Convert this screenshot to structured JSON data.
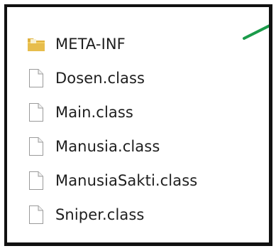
{
  "window": {
    "border_color": "#111111",
    "annotation_arrow_color": "#1a9b4a"
  },
  "files": [
    {
      "name": "META-INF",
      "type": "folder",
      "icon": "folder-icon"
    },
    {
      "name": "Dosen.class",
      "type": "file",
      "icon": "file-icon"
    },
    {
      "name": "Main.class",
      "type": "file",
      "icon": "file-icon"
    },
    {
      "name": "Manusia.class",
      "type": "file",
      "icon": "file-icon"
    },
    {
      "name": "ManusiaSakti.class",
      "type": "file",
      "icon": "file-icon"
    },
    {
      "name": "Sniper.class",
      "type": "file",
      "icon": "file-icon"
    }
  ]
}
